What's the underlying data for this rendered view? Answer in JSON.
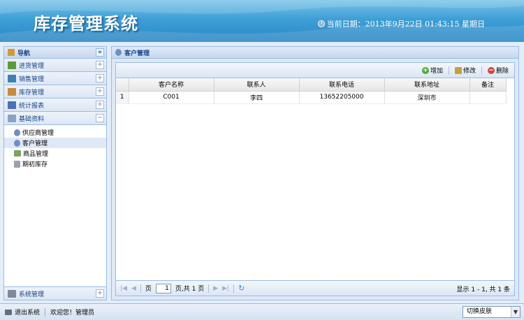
{
  "header": {
    "title": "库存管理系统",
    "date_text": "当前日期：2013年9月22日  01:43:15 星期日"
  },
  "nav": {
    "title": "导航",
    "collapse_icon": "«",
    "sections": [
      {
        "label": "进货管理",
        "icon": "purchase-icon",
        "color": "#5a9a3c"
      },
      {
        "label": "销售管理",
        "icon": "sales-icon",
        "color": "#3d7fb8"
      },
      {
        "label": "库存管理",
        "icon": "inventory-icon",
        "color": "#c98a3a"
      },
      {
        "label": "统计报表",
        "icon": "chart-icon",
        "color": "#4a72b5"
      },
      {
        "label": "基础资料",
        "icon": "base-data-icon",
        "color": "#8aa3c2"
      }
    ],
    "tree": [
      {
        "label": "供应商管理",
        "icon": "user-icon"
      },
      {
        "label": "客户管理",
        "icon": "user-icon"
      },
      {
        "label": "商品管理",
        "icon": "goods-icon"
      },
      {
        "label": "期初库存",
        "icon": "db-icon"
      }
    ],
    "bottom_section": "系统管理",
    "plus": "+",
    "minus": "−"
  },
  "main": {
    "tab_title": "客户管理",
    "toolbar": {
      "add": "增加",
      "edit": "修改",
      "delete": "删除"
    },
    "columns": [
      "客户名称",
      "联系人",
      "联系电话",
      "联系地址",
      "备注"
    ],
    "rows": [
      {
        "num": "1",
        "name": "C001",
        "contact": "李四",
        "phone": "13652205000",
        "address": "深圳市",
        "note": ""
      }
    ],
    "pager": {
      "page_label": "页",
      "page_value": "1",
      "page_total": "页,共 1 页",
      "info": "显示 1 - 1, 共 1 条"
    }
  },
  "footer": {
    "logout": "退出系统",
    "welcome": "欢迎您！管理员",
    "skin": "切换皮肤"
  }
}
